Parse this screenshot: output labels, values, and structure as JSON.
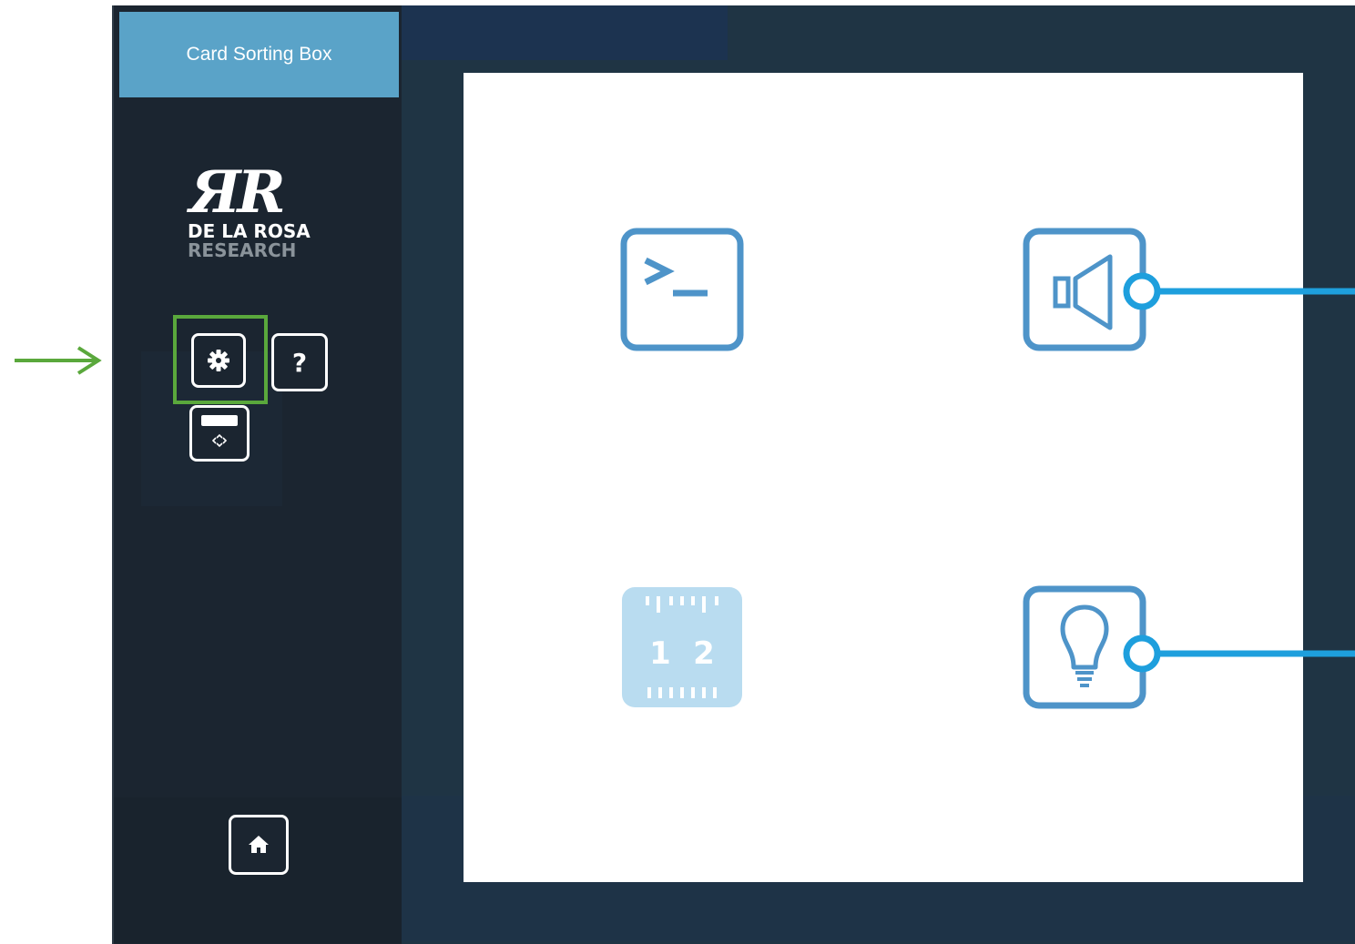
{
  "app": {
    "title": "Card Sorting Box"
  },
  "logo": {
    "line1": "DE LA ROSA",
    "line2": "RESEARCH"
  },
  "sidebar": {
    "settings_icon": "gear-icon",
    "help_label": "?",
    "window_icon": "window-move-icon",
    "home_icon": "home-icon"
  },
  "cards": [
    {
      "icon": "terminal-icon"
    },
    {
      "icon": "speaker-icon"
    },
    {
      "icon": "ruler-icon"
    },
    {
      "icon": "lightbulb-icon"
    }
  ],
  "colors": {
    "accent": "#5aa3c8",
    "icon_blue": "#4e94c9",
    "callout_blue": "#1e9fdd",
    "highlight_green": "#5aa83c",
    "sidebar_bg": "#1b2530",
    "main_bg": "#1f3444"
  }
}
